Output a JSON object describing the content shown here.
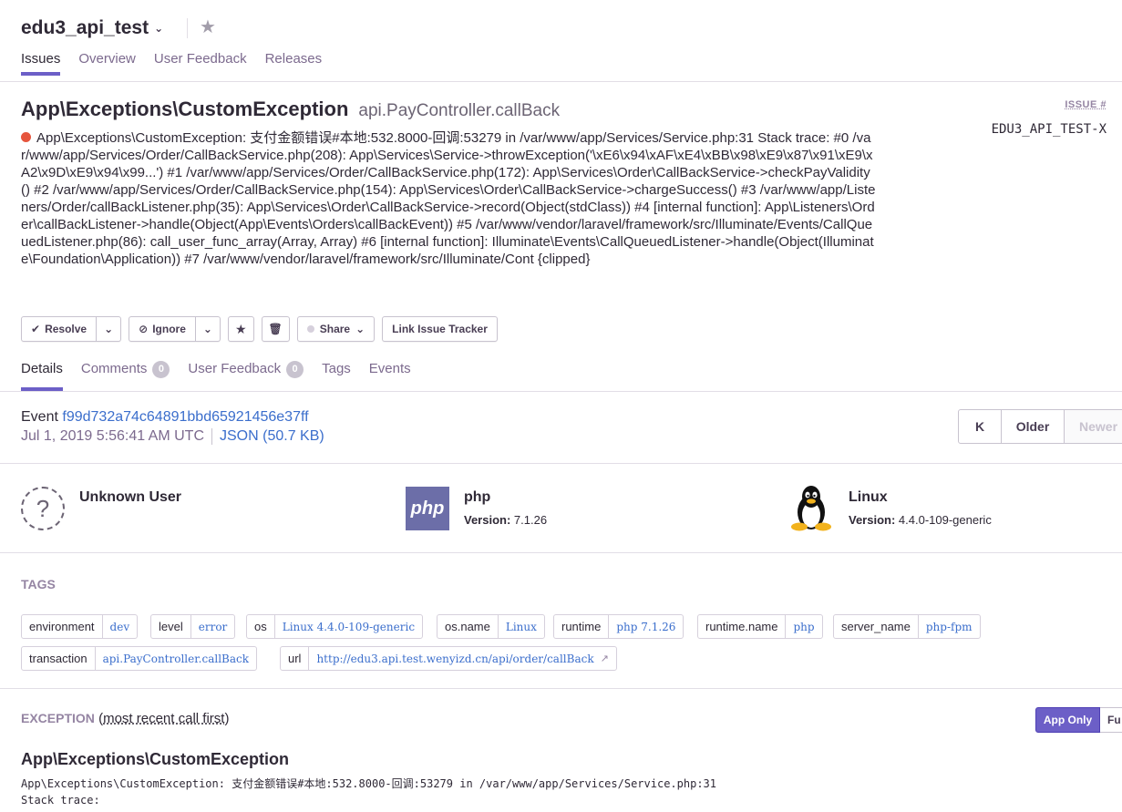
{
  "project": {
    "name": "edu3_api_test",
    "tabs": [
      "Issues",
      "Overview",
      "User Feedback",
      "Releases"
    ]
  },
  "issue": {
    "title": "App\\Exceptions\\CustomException",
    "culprit": "api.PayController.callBack",
    "number_label": "ISSUE #",
    "number": "EDU3_API_TEST-X",
    "message": "App\\Exceptions\\CustomException: 支付金额错误#本地:532.8000-回调:53279 in /var/www/app/Services/Service.php:31 Stack trace: #0 /var/www/app/Services/Order/CallBackService.php(208): App\\Services\\Service->throwException('\\xE6\\x94\\xAF\\xE4\\xBB\\x98\\xE9\\x87\\x91\\xE9\\xA2\\x9D\\xE9\\x94\\x99...') #1 /var/www/app/Services/Order/CallBackService.php(172): App\\Services\\Order\\CallBackService->checkPayValidity() #2 /var/www/app/Services/Order/CallBackService.php(154): App\\Services\\Order\\CallBackService->chargeSuccess() #3 /var/www/app/Listeners/Order/callBackListener.php(35): App\\Services\\Order\\CallBackService->record(Object(stdClass)) #4 [internal function]: App\\Listeners\\Order\\callBackListener->handle(Object(App\\Events\\Orders\\callBackEvent)) #5 /var/www/vendor/laravel/framework/src/Illuminate/Events/CallQueuedListener.php(86): call_user_func_array(Array, Array) #6 [internal function]: Illuminate\\Events\\CallQueuedListener->handle(Object(Illuminate\\Foundation\\Application)) #7 /var/www/vendor/laravel/framework/src/Illuminate/Cont {clipped}"
  },
  "actions": {
    "resolve": "Resolve",
    "ignore": "Ignore",
    "share": "Share",
    "link_tracker": "Link Issue Tracker"
  },
  "detail_tabs": {
    "details": "Details",
    "comments": "Comments",
    "comments_count": "0",
    "user_feedback": "User Feedback",
    "user_feedback_count": "0",
    "tags": "Tags",
    "events": "Events"
  },
  "event": {
    "label": "Event",
    "id": "f99d732a74c64891bbd65921456e37ff",
    "timestamp": "Jul 1, 2019 5:56:41 AM UTC",
    "json": "JSON (50.7 KB)",
    "pager_first": "K",
    "pager_older": "Older",
    "pager_newer": "Newer"
  },
  "context": {
    "user": {
      "title": "Unknown User"
    },
    "runtime": {
      "title": "php",
      "version_label": "Version:",
      "version": "7.1.26",
      "logo_text": "php"
    },
    "os": {
      "title": "Linux",
      "version_label": "Version:",
      "version": "4.4.0-109-generic"
    }
  },
  "tags": {
    "label": "TAGS",
    "items": [
      {
        "key": "environment",
        "value": "dev"
      },
      {
        "key": "level",
        "value": "error"
      },
      {
        "key": "os",
        "value": "Linux 4.4.0-109-generic"
      },
      {
        "key": "os.name",
        "value": "Linux"
      },
      {
        "key": "runtime",
        "value": "php 7.1.26"
      },
      {
        "key": "runtime.name",
        "value": "php"
      },
      {
        "key": "server_name",
        "value": "php-fpm"
      },
      {
        "key": "transaction",
        "value": "api.PayController.callBack"
      },
      {
        "key": "url",
        "value": "http://edu3.api.test.wenyizd.cn/api/order/callBack"
      }
    ]
  },
  "exception": {
    "heading": "EXCEPTION",
    "open_paren": "(",
    "order_link": "most recent call first",
    "close_paren": ")",
    "app_only": "App Only",
    "full": "Fu",
    "title": "App\\Exceptions\\CustomException",
    "message_lines": [
      "App\\Exceptions\\CustomException: 支付金额错误#本地:532.8000-回调:53279 in /var/www/app/Services/Service.php:31",
      "Stack trace:"
    ]
  },
  "colors": {
    "accent": "#6c5fc7",
    "link": "#3b6ecc",
    "error": "#e6553d"
  }
}
